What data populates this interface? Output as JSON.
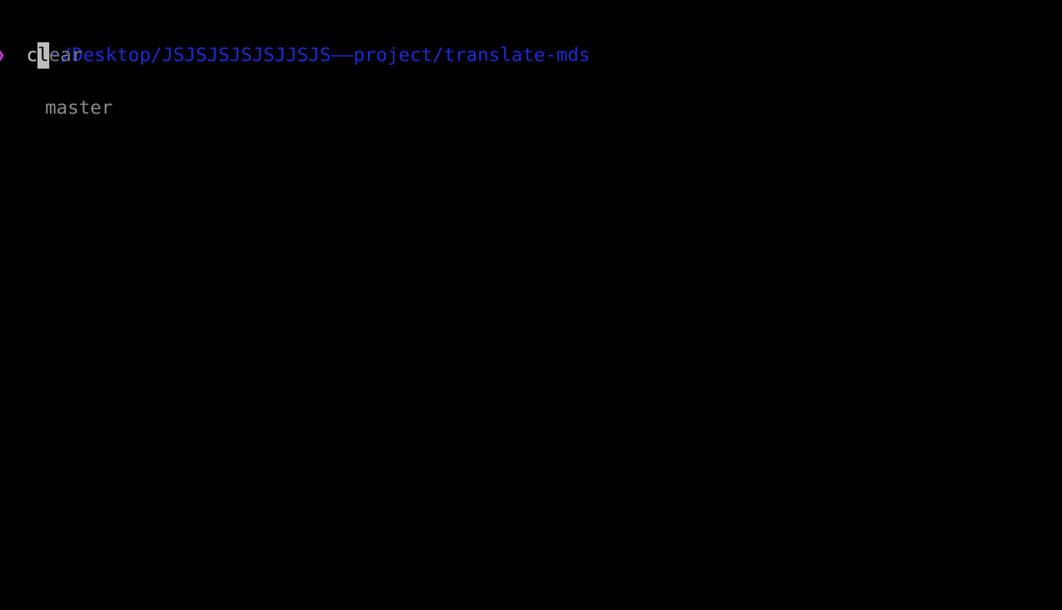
{
  "terminal": {
    "cwd": "~/Desktop/JSJSJSJSJSJJSJS——project/translate-mds",
    "git_branch": "master",
    "prompt_symbol": "❯",
    "input": {
      "typed": "c",
      "cursor_char": "l",
      "autosuggest_rest": "ear"
    },
    "colors": {
      "background": "#000000",
      "path": "#1a2bd6",
      "branch": "#8a8a8a",
      "prompt": "#c23ad0",
      "cursor": "#bdbdbd"
    }
  }
}
